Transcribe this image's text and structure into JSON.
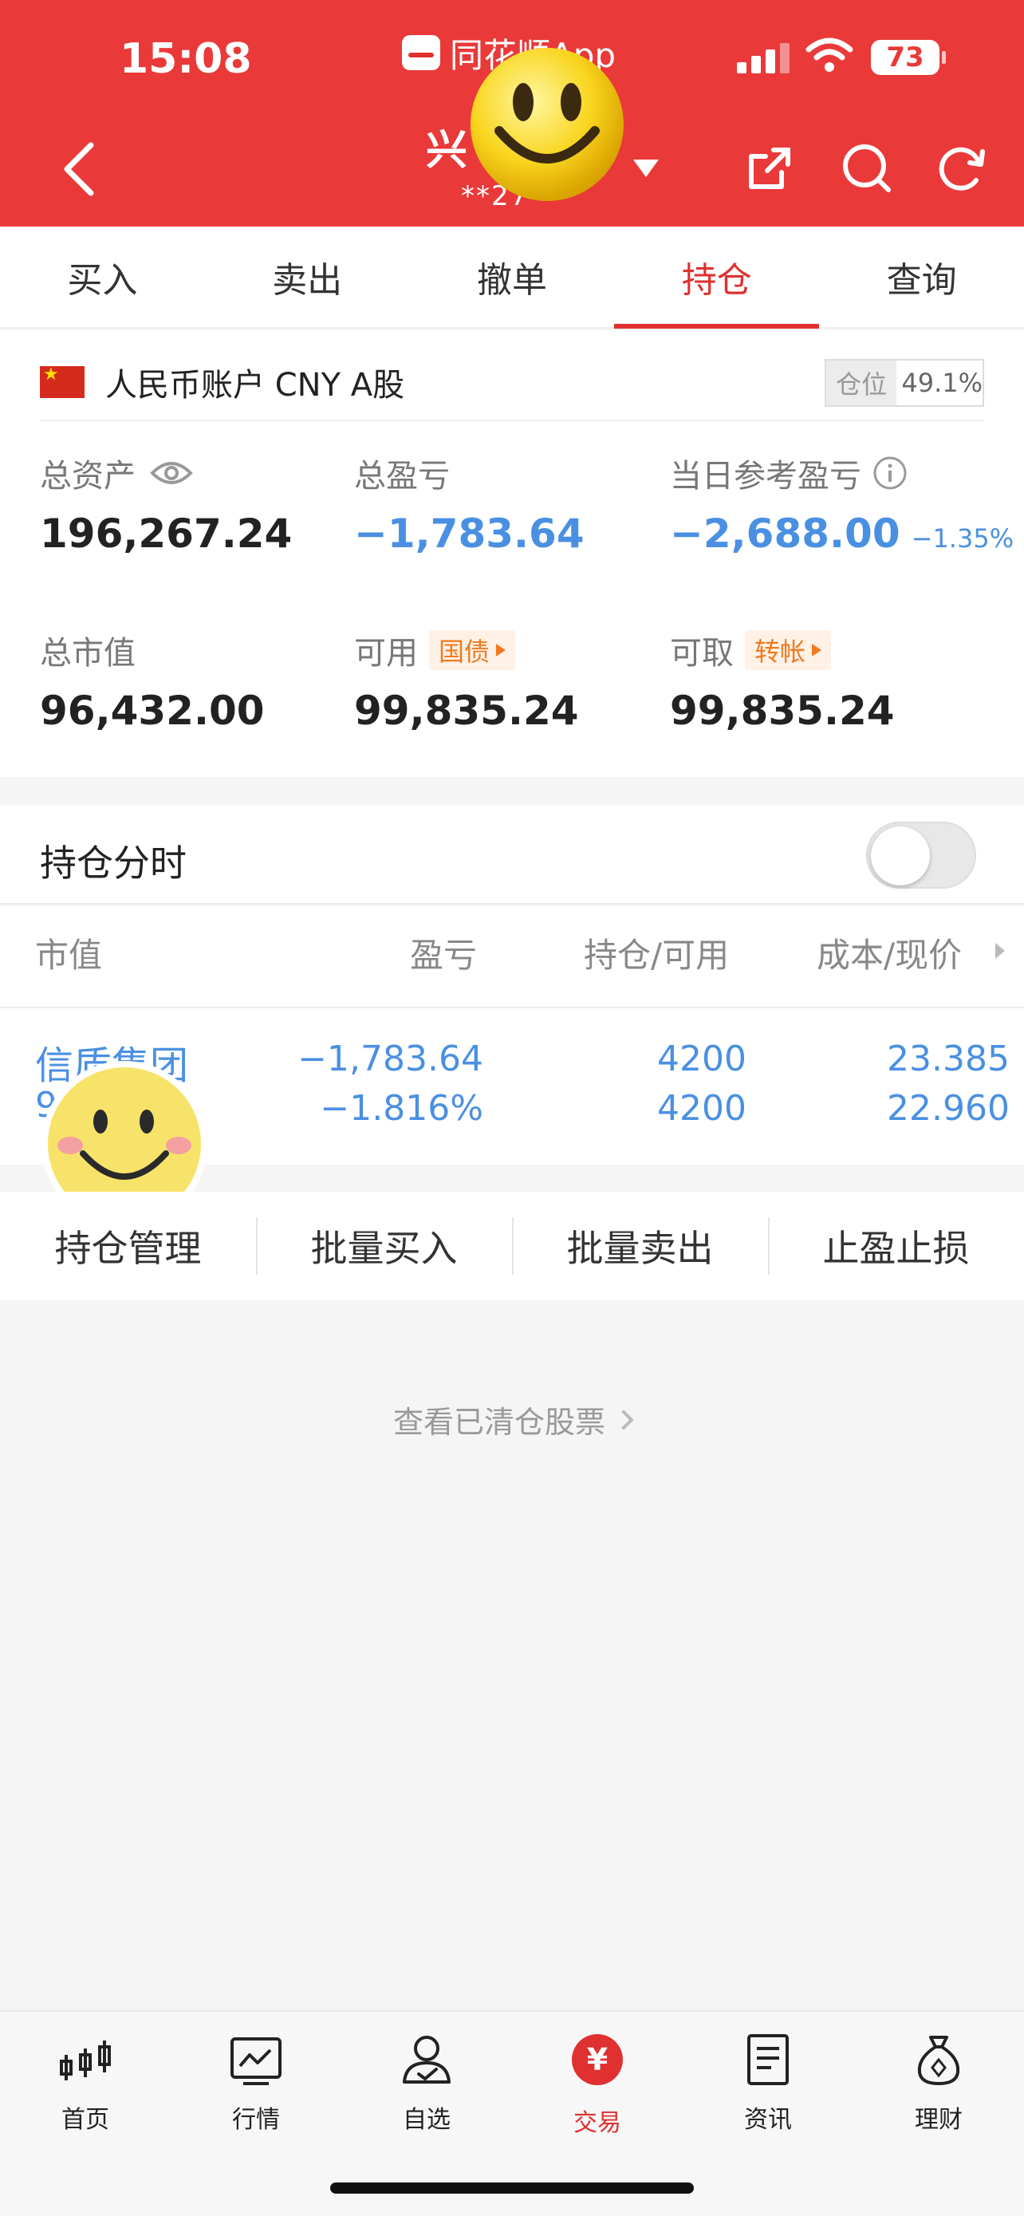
{
  "status_bar": {
    "time": "15:08",
    "app_name": "同花顺App",
    "battery": "73"
  },
  "header": {
    "account_name": "兴",
    "account_no": "**27",
    "accent": "#ea3939"
  },
  "tabs": [
    {
      "label": "买入"
    },
    {
      "label": "卖出"
    },
    {
      "label": "撤单"
    },
    {
      "label": "持仓",
      "active": true
    },
    {
      "label": "查询"
    }
  ],
  "account": {
    "label": "人民币账户 CNY A股",
    "position_label": "仓位",
    "position_value": "49.1%"
  },
  "stats": {
    "total_assets": {
      "label": "总资产",
      "value": "196,267.24"
    },
    "total_pnl": {
      "label": "总盈亏",
      "value": "−1,783.64"
    },
    "daily_pnl": {
      "label": "当日参考盈亏",
      "value": "−2,688.00",
      "pct": "−1.35%"
    },
    "market_value": {
      "label": "总市值",
      "value": "96,432.00"
    },
    "available": {
      "label": "可用",
      "value": "99,835.24",
      "tag": "国债"
    },
    "withdrawable": {
      "label": "可取",
      "value": "99,835.24",
      "tag": "转帐"
    }
  },
  "timeline": {
    "label": "持仓分时",
    "enabled": false
  },
  "table": {
    "headers": [
      "市值",
      "盈亏",
      "持仓/可用",
      "成本/现价"
    ],
    "rows": [
      {
        "name": "信质集团",
        "market_value": "9",
        "pnl": "−1,783.64",
        "pnl_pct": "−1.816%",
        "holding": "4200",
        "available": "4200",
        "cost": "23.385",
        "price": "22.960"
      }
    ]
  },
  "actions": [
    "持仓管理",
    "批量买入",
    "批量卖出",
    "止盈止损"
  ],
  "cleared_link": "查看已清仓股票",
  "bottom_nav": [
    {
      "label": "首页",
      "icon": "candlestick-icon"
    },
    {
      "label": "行情",
      "icon": "chart-icon"
    },
    {
      "label": "自选",
      "icon": "user-check-icon"
    },
    {
      "label": "交易",
      "icon": "yuan-icon",
      "symbol": "¥",
      "active": true
    },
    {
      "label": "资讯",
      "icon": "document-icon"
    },
    {
      "label": "理财",
      "icon": "moneybag-icon"
    }
  ]
}
